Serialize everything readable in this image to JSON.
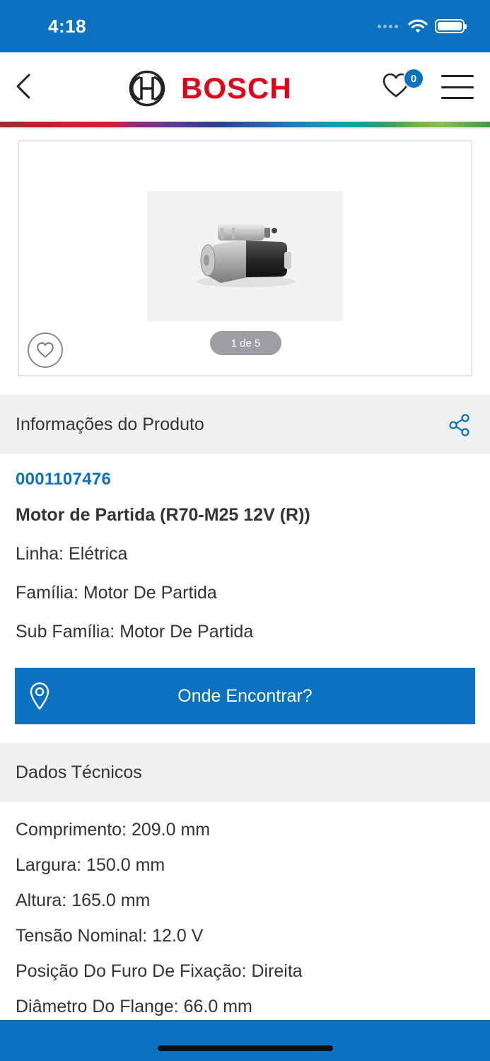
{
  "status_bar": {
    "time": "4:18"
  },
  "header": {
    "brand": "BOSCH",
    "favorites_count": "0"
  },
  "gallery": {
    "pager": "1 de 5"
  },
  "product_section": {
    "title": "Informações do Produto",
    "part_number": "0001107476",
    "name": "Motor de Partida (R70-M25 12V (R))",
    "lines": [
      "Linha: Elétrica",
      "Família: Motor De Partida",
      "Sub Família: Motor De Partida"
    ],
    "find_button": "Onde Encontrar?"
  },
  "tech_section": {
    "title": "Dados Técnicos",
    "lines": [
      "Comprimento: 209.0 mm",
      "Largura: 150.0 mm",
      "Altura: 165.0 mm",
      "Tensão Nominal: 12.0 V",
      "Posição Do Furo De Fixação: Direita",
      "Diâmetro Do Flange: 66.0 mm"
    ]
  },
  "colors": {
    "primary": "#0a72c0",
    "brand_red": "#e2001a",
    "section_bg": "#eff0f1"
  },
  "icons": [
    "back-icon",
    "bosch-emblem-icon",
    "heart-icon",
    "menu-icon",
    "share-icon",
    "location-pin-icon",
    "wifi-icon",
    "battery-icon"
  ]
}
